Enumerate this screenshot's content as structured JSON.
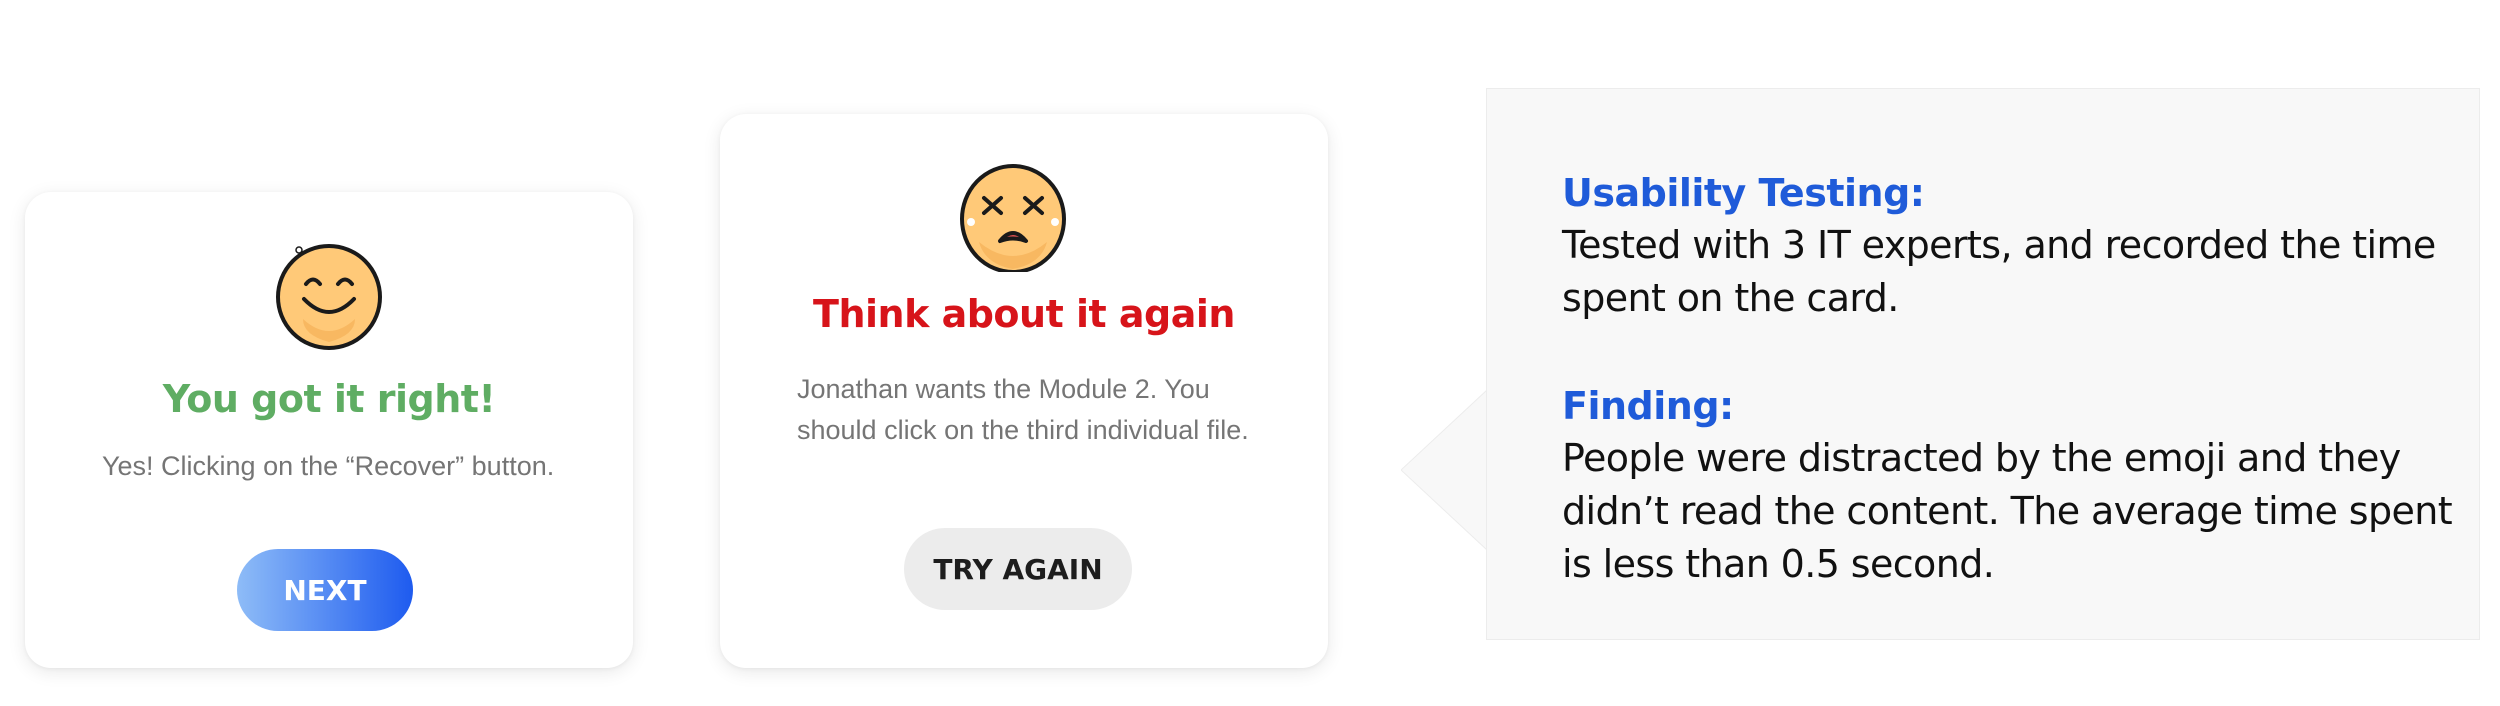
{
  "correct_card": {
    "title": "You got it right!",
    "body": "Yes! Clicking on the “Recover” button.",
    "button_label": "NEXT",
    "emoji": "smiling-face-icon",
    "title_color": "#5fad63"
  },
  "wrong_card": {
    "title": "Think about it again",
    "body": "Jonathan wants the Module 2. You should click on the third individual file.",
    "button_label": "TRY AGAIN",
    "emoji": "dizzy-face-icon",
    "title_color": "#d7141a"
  },
  "panel": {
    "usability_heading": "Usability Testing:",
    "usability_text": "Tested with 3 IT experts, and recorded the time spent on the card.",
    "finding_heading": "Finding:",
    "finding_text": "People were distracted by the emoji and they didn’t read the content. The average time spent is less than 0.5 second.",
    "heading_color": "#1f5bd9"
  },
  "colors": {
    "next_button_gradient_start": "#8ebcf7",
    "next_button_gradient_end": "#1e5bef",
    "emoji_fill": "#ffc978"
  }
}
